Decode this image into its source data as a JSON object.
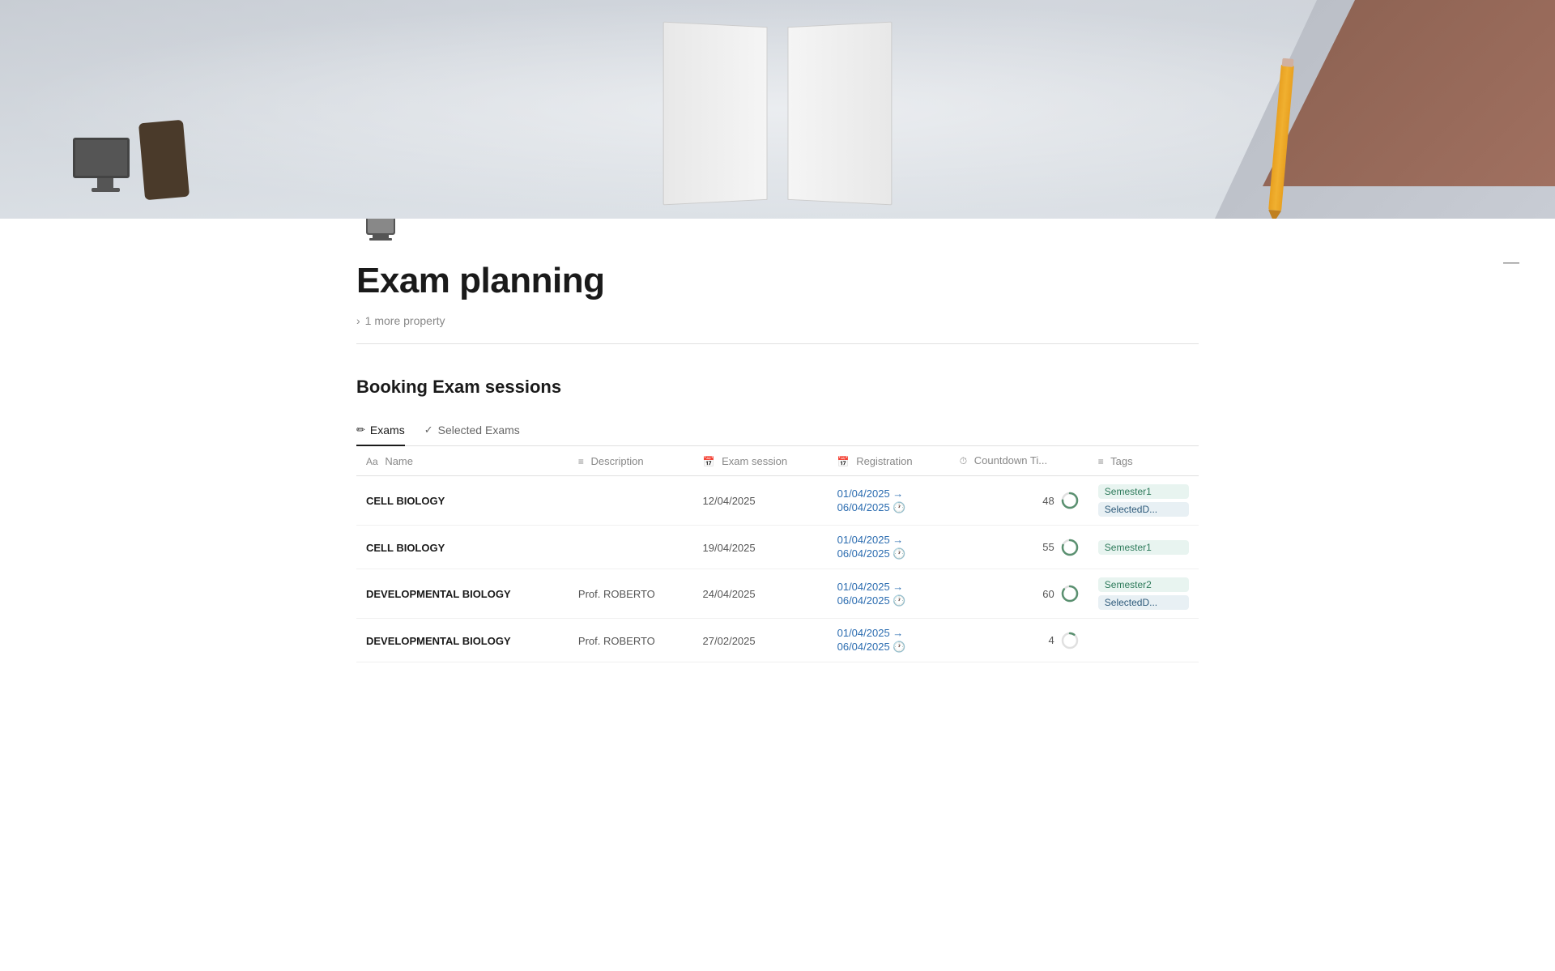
{
  "hero": {
    "alt": "Exam planning hero image with notebook, pencil, laptop and phone"
  },
  "page": {
    "icon": "monitor",
    "title": "Exam planning",
    "more_property_label": "1 more property"
  },
  "minimize_btn": "—",
  "section": {
    "title": "Booking Exam sessions"
  },
  "tabs": [
    {
      "id": "exams",
      "icon": "✏️",
      "label": "Exams",
      "active": true
    },
    {
      "id": "selected-exams",
      "icon": "✓",
      "label": "Selected Exams",
      "active": false
    }
  ],
  "table": {
    "columns": [
      {
        "id": "name",
        "icon": "Aa",
        "label": "Name"
      },
      {
        "id": "description",
        "icon": "☰",
        "label": "Description"
      },
      {
        "id": "exam-session",
        "icon": "📅",
        "label": "Exam session"
      },
      {
        "id": "registration",
        "icon": "📅",
        "label": "Registration"
      },
      {
        "id": "countdown",
        "icon": "⏱",
        "label": "Countdown Ti..."
      },
      {
        "id": "tags",
        "icon": "☰",
        "label": "Tags"
      }
    ],
    "rows": [
      {
        "name": "CELL BIOLOGY",
        "description": "",
        "exam_session": "12/04/2025",
        "reg_start": "01/04/2025 →",
        "reg_end": "06/04/2025 🕐",
        "countdown": "48",
        "progress": 75,
        "tags": [
          "Semester1",
          "SelectedD..."
        ]
      },
      {
        "name": "CELL BIOLOGY",
        "description": "",
        "exam_session": "19/04/2025",
        "reg_start": "01/04/2025 →",
        "reg_end": "06/04/2025 🕐",
        "countdown": "55",
        "progress": 80,
        "tags": [
          "Semester1"
        ]
      },
      {
        "name": "DEVELOPMENTAL BIOLOGY",
        "description": "Prof. ROBERTO",
        "exam_session": "24/04/2025",
        "reg_start": "01/04/2025 →",
        "reg_end": "06/04/2025 🕐",
        "countdown": "60",
        "progress": 85,
        "tags": [
          "Semester2",
          "SelectedD..."
        ]
      },
      {
        "name": "DEVELOPMENTAL BIOLOGY",
        "description": "Prof. ROBERTO",
        "exam_session": "27/02/2025",
        "reg_start": "01/04/2025 →",
        "reg_end": "06/04/2025 🕐",
        "countdown": "4",
        "progress": 10,
        "tags": []
      }
    ]
  },
  "colors": {
    "accent_blue": "#2b6cb0",
    "tag_semester1_bg": "#e8f4f0",
    "tag_semester1_text": "#2d7a5a",
    "tag_selected_bg": "#e8f0f4",
    "tag_selected_text": "#2d5a7a",
    "tag_semester2_bg": "#e8f4f0",
    "tag_semester2_text": "#2d7a5a"
  }
}
